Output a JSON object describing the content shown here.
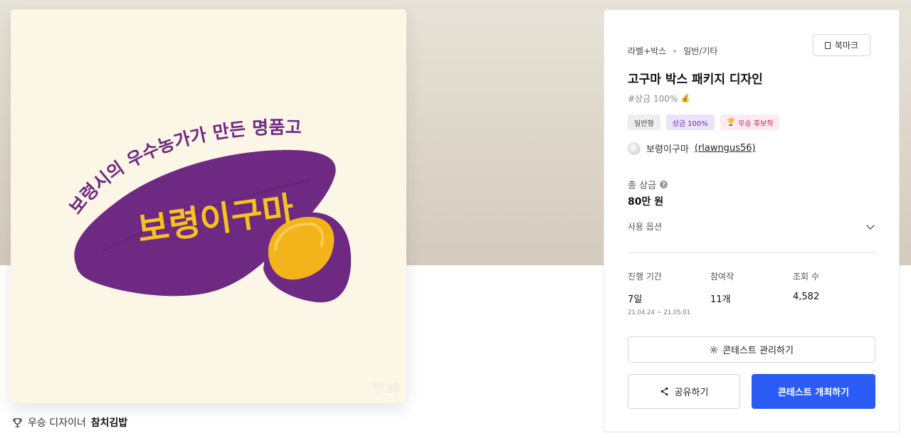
{
  "artwork": {
    "headline_text": "보령시의 우수농가가 만든 명품고구마",
    "brand_text": "보령이구마",
    "like_count": "15",
    "colors": {
      "background": "#fcf6e6",
      "potato": "#6e2a82",
      "flesh": "#f3b31a",
      "text_purple": "#6e2a82",
      "brand_text": "#f6c21d"
    }
  },
  "winner": {
    "label": "우승 디자이너",
    "name": "참치김밥"
  },
  "panel": {
    "bookmark_label": "북마크",
    "category_primary": "라벨+박스",
    "category_secondary": "일반/기타",
    "title": "고구마 박스 패키지 디자인",
    "prize_tag": "#상금 100%",
    "badges": [
      {
        "label": "일반형"
      },
      {
        "label": "상금 100%"
      },
      {
        "label": "우승 후보작",
        "icon": "trophy-icon"
      }
    ],
    "owner_name": "보령이구마",
    "owner_handle": "(rlawngus56)",
    "total_prize_label": "총 상금",
    "total_prize_value": "80만 원",
    "usage_label": "사용 옵션",
    "stats": [
      {
        "label": "진행 기간",
        "value": "7일",
        "sub": "21.04.24 ~ 21.05.01"
      },
      {
        "label": "참여작",
        "value": "11개",
        "sub": ""
      },
      {
        "label": "조회 수",
        "value": "4,582",
        "sub": ""
      }
    ],
    "manage_label": "콘테스트 관리하기",
    "share_label": "공유하기",
    "host_label": "콘테스트 개최하기",
    "accent_color": "#2a5bf4"
  }
}
